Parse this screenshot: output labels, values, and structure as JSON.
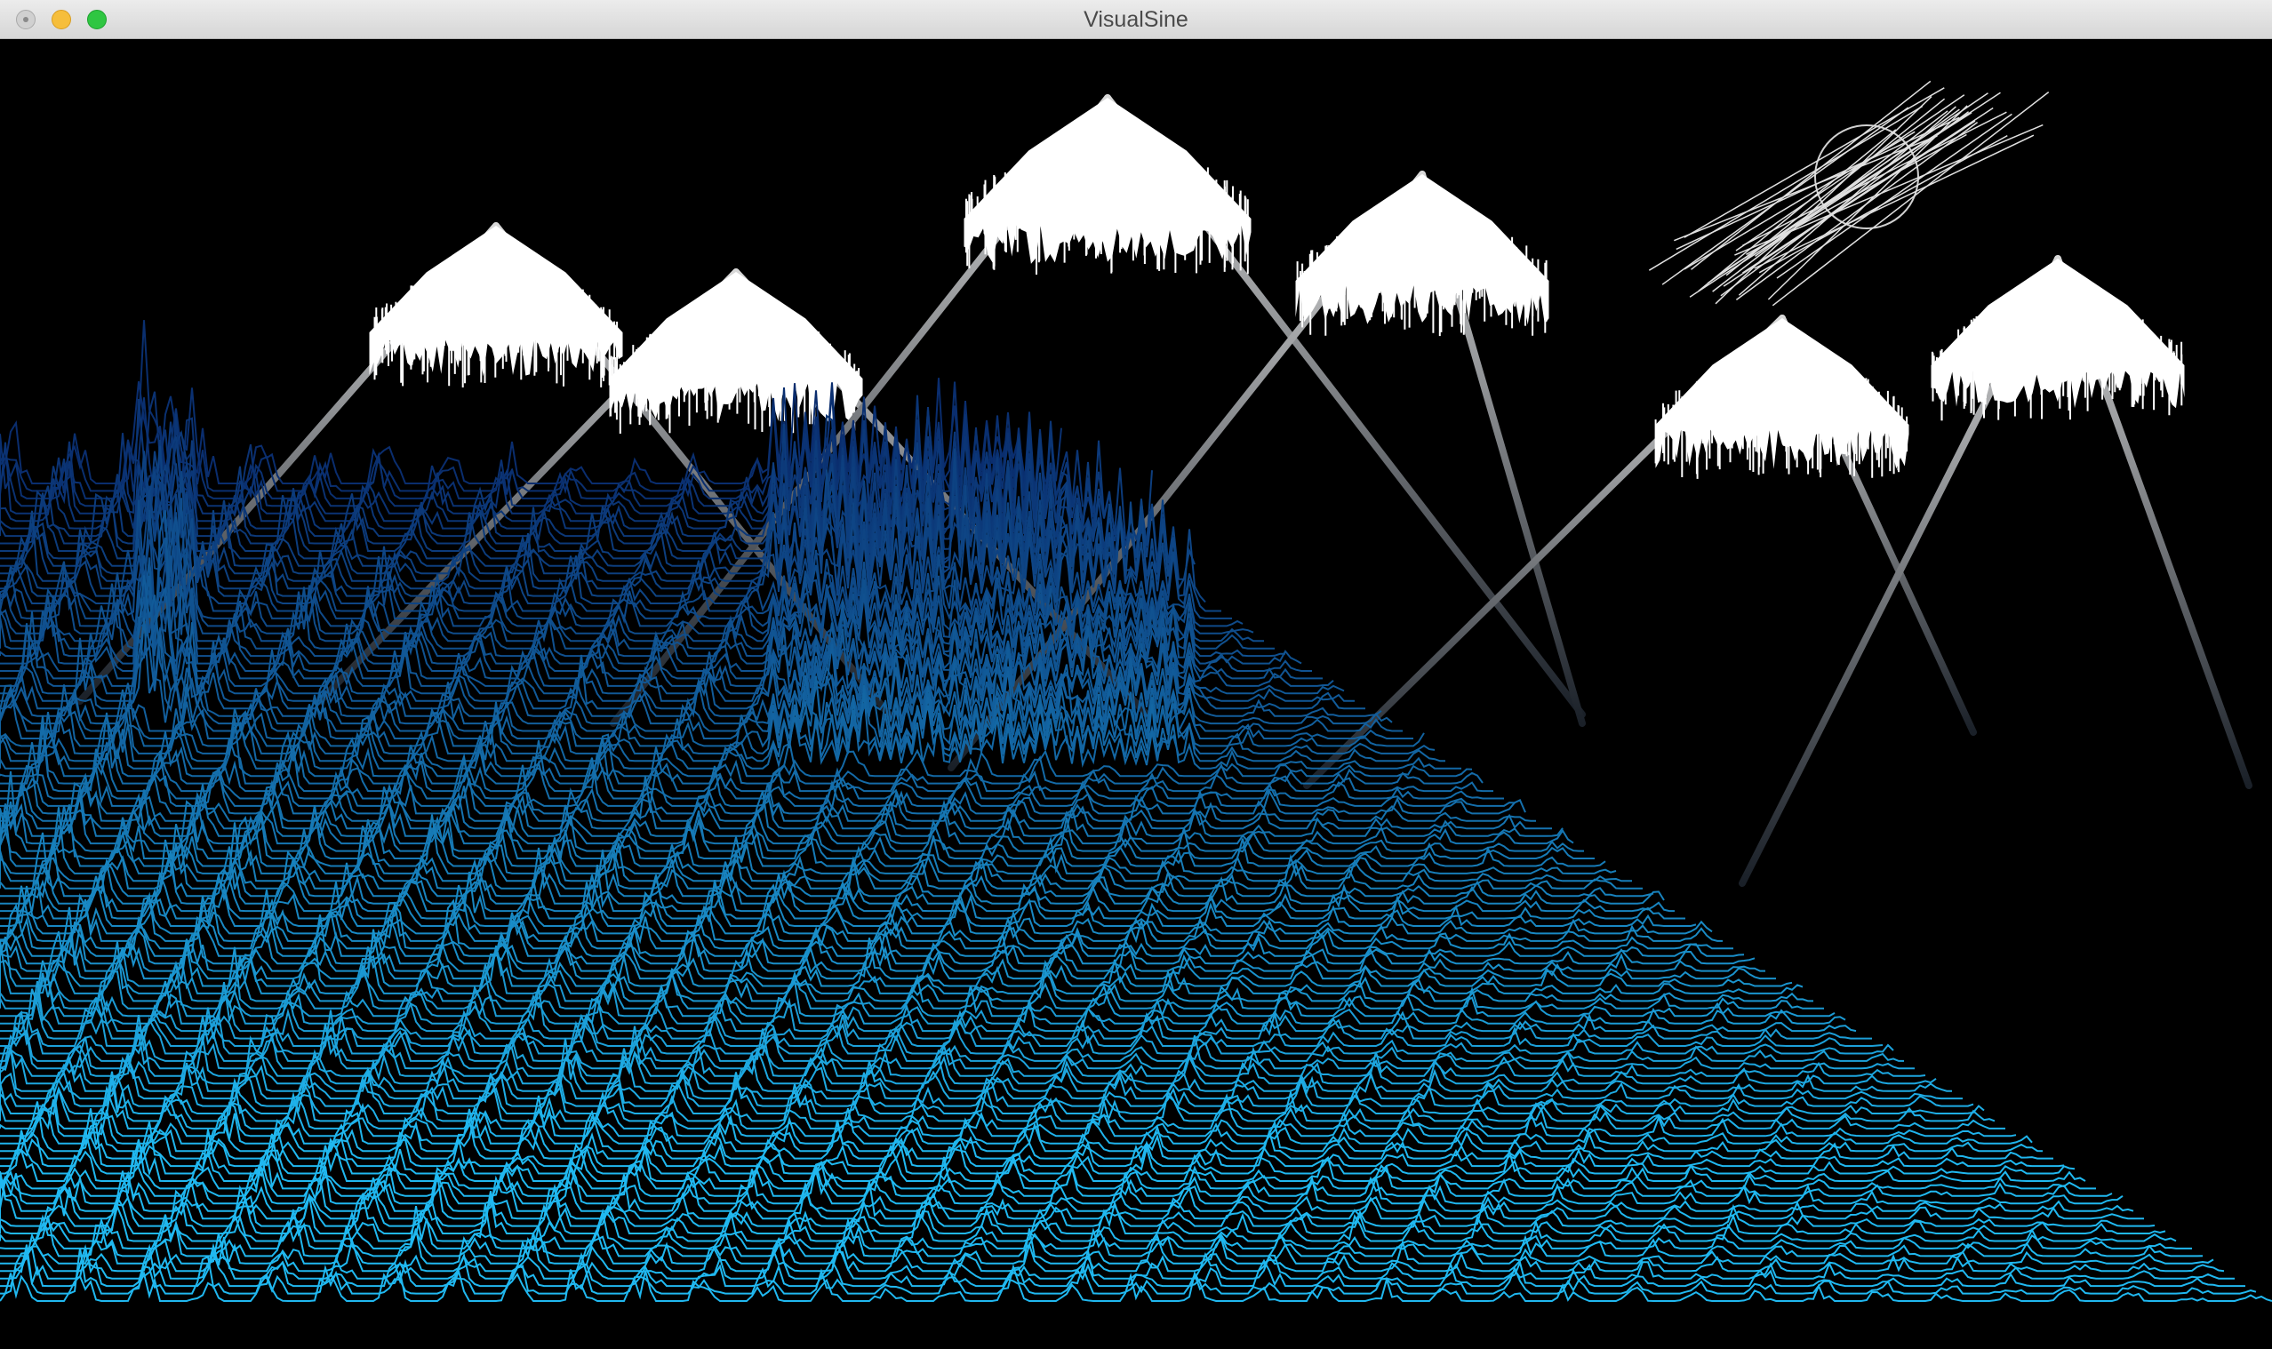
{
  "window": {
    "title": "VisualSine"
  },
  "scene": {
    "background": "#000000",
    "mountain_color": "#c8c8c8",
    "snow_color": "#ffffff",
    "wave_color_dark": "#0a2d6e",
    "wave_color_light": "#20b8f0",
    "icons": [
      "close-button-icon",
      "minimize-button-icon",
      "zoom-button-icon"
    ]
  }
}
